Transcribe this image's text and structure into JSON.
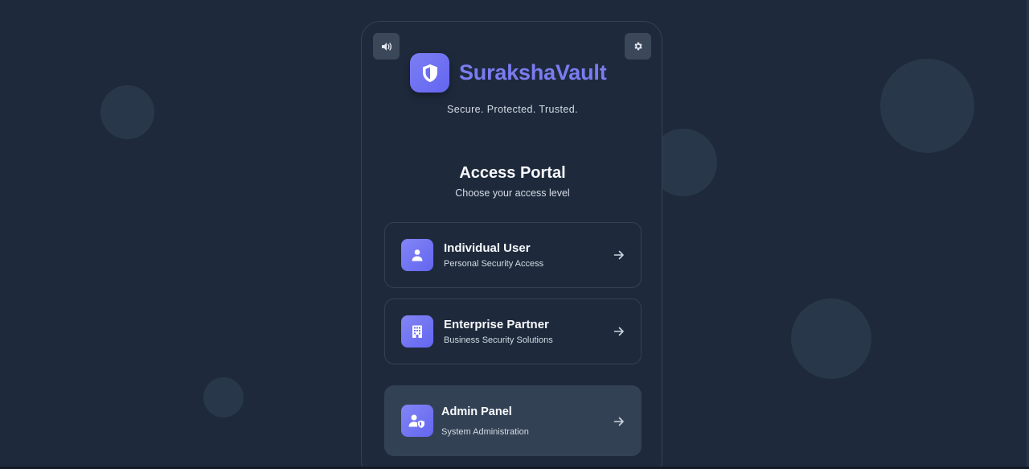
{
  "brand": {
    "name": "SurakshaVault",
    "tagline": "Secure. Protected. Trusted."
  },
  "portal": {
    "title": "Access Portal",
    "subtitle": "Choose your access level"
  },
  "options": [
    {
      "title": "Individual User",
      "subtitle": "Personal Security Access",
      "icon": "user-icon"
    },
    {
      "title": "Enterprise Partner",
      "subtitle": "Business Security Solutions",
      "icon": "building-icon"
    },
    {
      "title": "Admin Panel",
      "subtitle": "System Administration",
      "icon": "admin-shield-user-icon"
    }
  ],
  "toolbar": {
    "sound_icon": "speaker-icon",
    "settings_icon": "gear-icon"
  },
  "colors": {
    "background": "#1e293b",
    "card": "#1e2a3c",
    "accent": "#6366f1",
    "brand_text": "#7b7cf0"
  }
}
